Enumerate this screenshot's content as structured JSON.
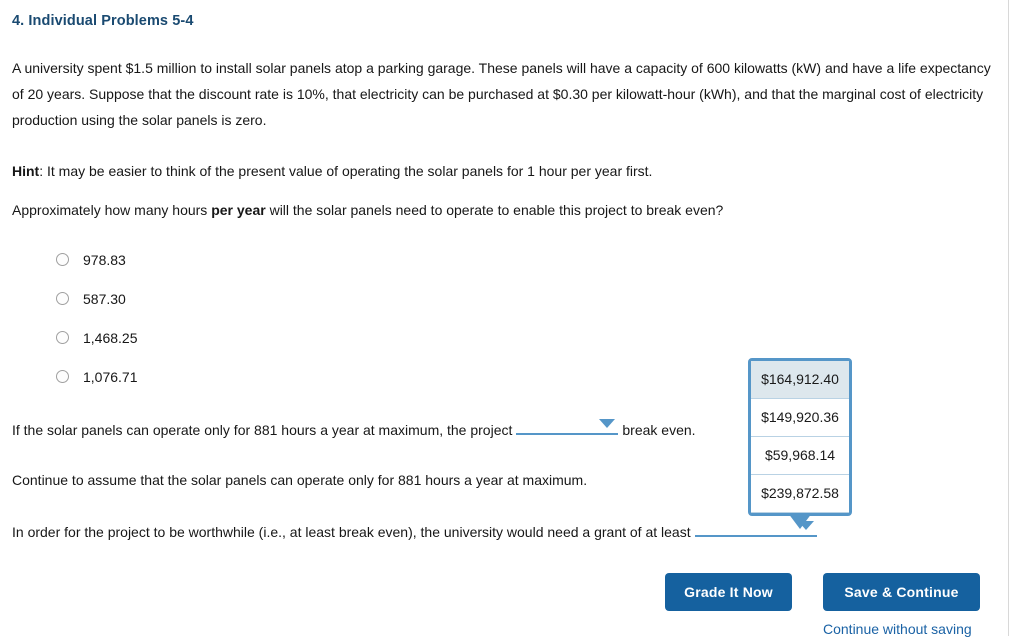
{
  "question": {
    "title": "4. Individual Problems 5-4",
    "paragraph": "A university spent $1.5 million to install solar panels atop a parking garage. These panels will have a capacity of 600 kilowatts (kW) and have a life expectancy of 20 years. Suppose that the discount rate is 10%, that electricity can be purchased at $0.30 per kilowatt-hour (kWh), and that the marginal cost of electricity production using the solar panels is zero.",
    "hint_label": "Hint",
    "hint_text": ": It may be easier to think of the present value of operating the solar panels for 1 hour per year first.",
    "prompt_pre": "Approximately how many hours ",
    "prompt_bold": "per year",
    "prompt_post": " will the solar panels need to operate to enable this project to break even?"
  },
  "options": [
    {
      "label": "978.83",
      "selected": false
    },
    {
      "label": "587.30",
      "selected": false
    },
    {
      "label": "1,468.25",
      "selected": false
    },
    {
      "label": "1,076.71",
      "selected": false
    }
  ],
  "statements": {
    "if_line_pre": "If the solar panels can operate only for 881 hours a year at maximum, the project",
    "if_line_post": "break even.",
    "continue_line": "Continue to assume that the solar panels can operate only for 881 hours a year at maximum.",
    "in_order_line": "In order for the project to be worthwhile (i.e., at least break even), the university would need a grant of at least"
  },
  "selects": {
    "break_even_value": "",
    "grant_value": ""
  },
  "dropdown": {
    "options": [
      {
        "label": "$164,912.40",
        "highlighted": true
      },
      {
        "label": "$149,920.36",
        "highlighted": false
      },
      {
        "label": "$59,968.14",
        "highlighted": false
      },
      {
        "label": "$239,872.58",
        "highlighted": false
      }
    ]
  },
  "footer": {
    "grade_label": "Grade It Now",
    "save_label": "Save & Continue",
    "continue_without_saving": "Continue without saving"
  },
  "colors": {
    "title": "#1a4a71",
    "button": "#15619f",
    "dropdown_border": "#5596c8",
    "dropdown_highlight": "#dde7ed",
    "link": "#1a62a5"
  }
}
